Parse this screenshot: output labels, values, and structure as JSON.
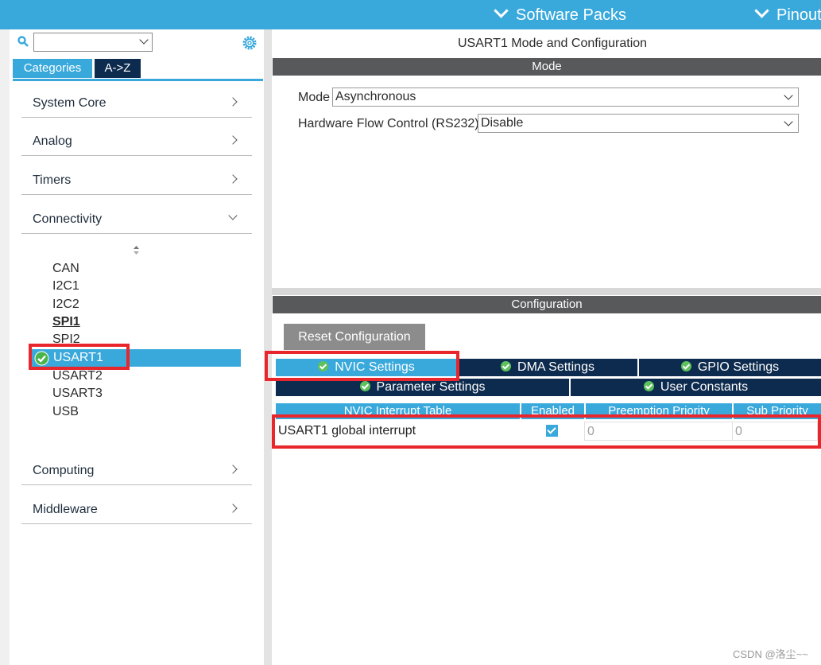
{
  "topbar": {
    "software_packs": "Software Packs",
    "pinout": "Pinout"
  },
  "sidebar": {
    "tabs": [
      "Categories",
      "A->Z"
    ],
    "categories": [
      {
        "label": "System Core"
      },
      {
        "label": "Analog"
      },
      {
        "label": "Timers"
      },
      {
        "label": "Connectivity"
      },
      {
        "label": "Computing"
      },
      {
        "label": "Middleware"
      }
    ],
    "connectivity_items": [
      "CAN",
      "I2C1",
      "I2C2",
      "SPI1",
      "SPI2",
      "USART1",
      "USART2",
      "USART3",
      "USB"
    ]
  },
  "main": {
    "title": "USART1 Mode and Configuration",
    "mode_header": "Mode",
    "mode_label": "Mode",
    "mode_value": "Asynchronous",
    "flow_label": "Hardware Flow Control (RS232)",
    "flow_value": "Disable",
    "config_header": "Configuration",
    "reset_button": "Reset Configuration",
    "tabs": [
      "NVIC Settings",
      "DMA Settings",
      "GPIO Settings",
      "Parameter Settings",
      "User Constants"
    ],
    "table": {
      "headers": [
        "NVIC Interrupt Table",
        "Enabled",
        "Preemption Priority",
        "Sub Priority"
      ],
      "rows": [
        {
          "name": "USART1 global interrupt",
          "enabled": true,
          "preemption": "0",
          "sub": "0"
        }
      ]
    }
  },
  "watermark": "CSDN @洛尘~~",
  "colors": {
    "accent": "#39a9dc",
    "dark_tab": "#0d2b4e",
    "section_bar": "#58595b",
    "highlight": "#e8262c"
  }
}
